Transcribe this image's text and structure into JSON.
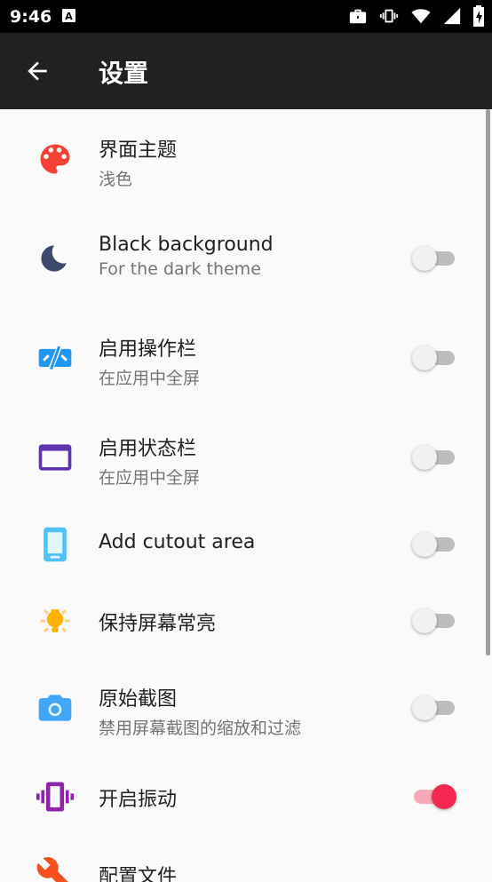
{
  "status_bar": {
    "time": "9:46"
  },
  "app_bar": {
    "title": "设置",
    "back_icon": "arrow-back-icon"
  },
  "settings": [
    {
      "title": "界面主题",
      "subtitle": "浅色",
      "icon": "palette-icon",
      "icon_color": "#f44336"
    },
    {
      "title": "Black background",
      "subtitle": "For the dark theme",
      "icon": "moon-icon",
      "icon_color": "#3d4a6b",
      "switch_on": false
    },
    {
      "title": "启用操作栏",
      "subtitle": "在应用中全屏",
      "icon": "fullscreen-action-bar-icon",
      "icon_color": "#2196f3",
      "switch_on": false
    },
    {
      "title": "启用状态栏",
      "subtitle": "在应用中全屏",
      "icon": "window-icon",
      "icon_color": "#5e35b1",
      "switch_on": false
    },
    {
      "title": "Add cutout area",
      "icon": "phone-cutout-icon",
      "icon_color": "#4fc3f7",
      "switch_on": false
    },
    {
      "title": "保持屏幕常亮",
      "icon": "lightbulb-icon",
      "icon_color": "#ffb300",
      "switch_on": false
    },
    {
      "title": "原始截图",
      "subtitle": "禁用屏幕截图的缩放和过滤",
      "icon": "camera-icon",
      "icon_color": "#42a5f5",
      "switch_on": false
    },
    {
      "title": "开启振动",
      "icon": "vibration-icon",
      "icon_color": "#8e24aa",
      "switch_on": true
    },
    {
      "title": "配置文件",
      "icon": "wrench-icon",
      "icon_color": "#f4511e"
    }
  ],
  "colors": {
    "accent": "#f52851",
    "app_bar": "#212121"
  }
}
